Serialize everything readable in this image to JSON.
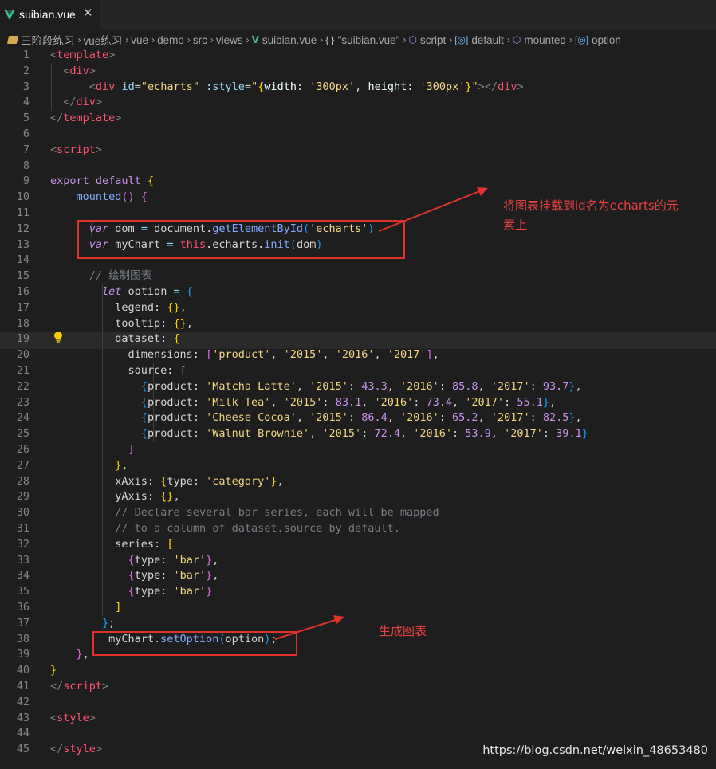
{
  "tab": {
    "title": "suibian.vue",
    "close": "✕"
  },
  "breadcrumb": [
    {
      "icon": "folder-icon",
      "label": "三阶段练习"
    },
    {
      "icon": "",
      "label": "vue练习"
    },
    {
      "icon": "",
      "label": "vue"
    },
    {
      "icon": "",
      "label": "demo"
    },
    {
      "icon": "",
      "label": "src"
    },
    {
      "icon": "",
      "label": "views"
    },
    {
      "icon": "vue-icon",
      "label": "suibian.vue"
    },
    {
      "icon": "braces-icon",
      "label": "\"suibian.vue\""
    },
    {
      "icon": "cube-icon",
      "label": "script"
    },
    {
      "icon": "module-icon",
      "label": "default"
    },
    {
      "icon": "cube-icon",
      "label": "mounted"
    },
    {
      "icon": "module-icon",
      "label": "option"
    }
  ],
  "line_numbers": [
    "1",
    "2",
    "3",
    "4",
    "5",
    "6",
    "7",
    "8",
    "9",
    "10",
    "11",
    "12",
    "13",
    "14",
    "15",
    "16",
    "17",
    "18",
    "19",
    "20",
    "21",
    "22",
    "23",
    "24",
    "25",
    "26",
    "27",
    "28",
    "29",
    "30",
    "31",
    "32",
    "33",
    "34",
    "35",
    "36",
    "37",
    "38",
    "39",
    "40",
    "41",
    "42",
    "43",
    "44",
    "45"
  ],
  "code": [
    [
      [
        "t-br",
        "<"
      ],
      [
        "t-tag",
        "template"
      ],
      [
        "t-br",
        ">"
      ]
    ],
    [
      [
        "t-def",
        "  "
      ],
      [
        "t-br",
        "<"
      ],
      [
        "t-tag",
        "div"
      ],
      [
        "t-br",
        ">"
      ]
    ],
    [
      [
        "t-def",
        "      "
      ],
      [
        "t-br",
        "<"
      ],
      [
        "t-tag",
        "div"
      ],
      [
        "t-def",
        " "
      ],
      [
        "t-attr",
        "id"
      ],
      [
        "t-def",
        "="
      ],
      [
        "t-str",
        "\"echarts\""
      ],
      [
        "t-def",
        " "
      ],
      [
        "t-attr",
        ":style"
      ],
      [
        "t-def",
        "="
      ],
      [
        "t-str",
        "\""
      ],
      [
        "t-br1",
        "{"
      ],
      [
        "t-prop",
        "width"
      ],
      [
        "t-def",
        ": "
      ],
      [
        "t-str",
        "'300px'"
      ],
      [
        "t-def",
        ", "
      ],
      [
        "t-prop",
        "height"
      ],
      [
        "t-def",
        ": "
      ],
      [
        "t-str",
        "'300px'"
      ],
      [
        "t-br1",
        "}"
      ],
      [
        "t-str",
        "\""
      ],
      [
        "t-br",
        ">"
      ],
      [
        "t-br",
        "</"
      ],
      [
        "t-tag",
        "div"
      ],
      [
        "t-br",
        ">"
      ]
    ],
    [
      [
        "t-def",
        "  "
      ],
      [
        "t-br",
        "</"
      ],
      [
        "t-tag",
        "div"
      ],
      [
        "t-br",
        ">"
      ]
    ],
    [
      [
        "t-br",
        "</"
      ],
      [
        "t-tag",
        "template"
      ],
      [
        "t-br",
        ">"
      ]
    ],
    [],
    [
      [
        "t-br",
        "<"
      ],
      [
        "t-tag",
        "script"
      ],
      [
        "t-br",
        ">"
      ]
    ],
    [],
    [
      [
        "t-kw",
        "export"
      ],
      [
        "t-def",
        " "
      ],
      [
        "t-kw",
        "default"
      ],
      [
        "t-def",
        " "
      ],
      [
        "t-br1",
        "{"
      ]
    ],
    [
      [
        "t-def",
        "    "
      ],
      [
        "t-fn",
        "mounted"
      ],
      [
        "t-br2",
        "()"
      ],
      [
        "t-def",
        " "
      ],
      [
        "t-br2",
        "{"
      ]
    ],
    [],
    [
      [
        "t-def",
        "      "
      ],
      [
        "t-kwi",
        "var"
      ],
      [
        "t-def",
        " dom "
      ],
      [
        "t-op",
        "="
      ],
      [
        "t-def",
        " document."
      ],
      [
        "t-fn",
        "getElementById"
      ],
      [
        "t-br3",
        "("
      ],
      [
        "t-str",
        "'echarts'"
      ],
      [
        "t-br3",
        ")"
      ]
    ],
    [
      [
        "t-def",
        "      "
      ],
      [
        "t-kwi",
        "var"
      ],
      [
        "t-def",
        " myChart "
      ],
      [
        "t-op",
        "="
      ],
      [
        "t-def",
        " "
      ],
      [
        "t-this",
        "this"
      ],
      [
        "t-def",
        ".echarts."
      ],
      [
        "t-fn",
        "init"
      ],
      [
        "t-br3",
        "("
      ],
      [
        "t-def",
        "dom"
      ],
      [
        "t-br3",
        ")"
      ]
    ],
    [],
    [
      [
        "t-def",
        "      "
      ],
      [
        "t-com",
        "// 绘制图表"
      ]
    ],
    [
      [
        "t-def",
        "        "
      ],
      [
        "t-kwi",
        "let"
      ],
      [
        "t-def",
        " option "
      ],
      [
        "t-op",
        "="
      ],
      [
        "t-def",
        " "
      ],
      [
        "t-br3",
        "{"
      ]
    ],
    [
      [
        "t-def",
        "          legend: "
      ],
      [
        "t-br1",
        "{}"
      ],
      [
        "t-def",
        ","
      ]
    ],
    [
      [
        "t-def",
        "          tooltip: "
      ],
      [
        "t-br1",
        "{}"
      ],
      [
        "t-def",
        ","
      ]
    ],
    [
      [
        "t-def",
        "          dataset: "
      ],
      [
        "t-br1",
        "{"
      ]
    ],
    [
      [
        "t-def",
        "            dimensions: "
      ],
      [
        "t-br2",
        "["
      ],
      [
        "t-str",
        "'product'"
      ],
      [
        "t-def",
        ", "
      ],
      [
        "t-str",
        "'2015'"
      ],
      [
        "t-def",
        ", "
      ],
      [
        "t-str",
        "'2016'"
      ],
      [
        "t-def",
        ", "
      ],
      [
        "t-str",
        "'2017'"
      ],
      [
        "t-br2",
        "]"
      ],
      [
        "t-def",
        ","
      ]
    ],
    [
      [
        "t-def",
        "            source: "
      ],
      [
        "t-br2",
        "["
      ]
    ],
    [
      [
        "t-def",
        "              "
      ],
      [
        "t-br3",
        "{"
      ],
      [
        "t-def",
        "product: "
      ],
      [
        "t-str",
        "'Matcha Latte'"
      ],
      [
        "t-def",
        ", "
      ],
      [
        "t-str",
        "'2015'"
      ],
      [
        "t-def",
        ": "
      ],
      [
        "t-num",
        "43.3"
      ],
      [
        "t-def",
        ", "
      ],
      [
        "t-str",
        "'2016'"
      ],
      [
        "t-def",
        ": "
      ],
      [
        "t-num",
        "85.8"
      ],
      [
        "t-def",
        ", "
      ],
      [
        "t-str",
        "'2017'"
      ],
      [
        "t-def",
        ": "
      ],
      [
        "t-num",
        "93.7"
      ],
      [
        "t-br3",
        "}"
      ],
      [
        "t-def",
        ","
      ]
    ],
    [
      [
        "t-def",
        "              "
      ],
      [
        "t-br3",
        "{"
      ],
      [
        "t-def",
        "product: "
      ],
      [
        "t-str",
        "'Milk Tea'"
      ],
      [
        "t-def",
        ", "
      ],
      [
        "t-str",
        "'2015'"
      ],
      [
        "t-def",
        ": "
      ],
      [
        "t-num",
        "83.1"
      ],
      [
        "t-def",
        ", "
      ],
      [
        "t-str",
        "'2016'"
      ],
      [
        "t-def",
        ": "
      ],
      [
        "t-num",
        "73.4"
      ],
      [
        "t-def",
        ", "
      ],
      [
        "t-str",
        "'2017'"
      ],
      [
        "t-def",
        ": "
      ],
      [
        "t-num",
        "55.1"
      ],
      [
        "t-br3",
        "}"
      ],
      [
        "t-def",
        ","
      ]
    ],
    [
      [
        "t-def",
        "              "
      ],
      [
        "t-br3",
        "{"
      ],
      [
        "t-def",
        "product: "
      ],
      [
        "t-str",
        "'Cheese Cocoa'"
      ],
      [
        "t-def",
        ", "
      ],
      [
        "t-str",
        "'2015'"
      ],
      [
        "t-def",
        ": "
      ],
      [
        "t-num",
        "86.4"
      ],
      [
        "t-def",
        ", "
      ],
      [
        "t-str",
        "'2016'"
      ],
      [
        "t-def",
        ": "
      ],
      [
        "t-num",
        "65.2"
      ],
      [
        "t-def",
        ", "
      ],
      [
        "t-str",
        "'2017'"
      ],
      [
        "t-def",
        ": "
      ],
      [
        "t-num",
        "82.5"
      ],
      [
        "t-br3",
        "}"
      ],
      [
        "t-def",
        ","
      ]
    ],
    [
      [
        "t-def",
        "              "
      ],
      [
        "t-br3",
        "{"
      ],
      [
        "t-def",
        "product: "
      ],
      [
        "t-str",
        "'Walnut Brownie'"
      ],
      [
        "t-def",
        ", "
      ],
      [
        "t-str",
        "'2015'"
      ],
      [
        "t-def",
        ": "
      ],
      [
        "t-num",
        "72.4"
      ],
      [
        "t-def",
        ", "
      ],
      [
        "t-str",
        "'2016'"
      ],
      [
        "t-def",
        ": "
      ],
      [
        "t-num",
        "53.9"
      ],
      [
        "t-def",
        ", "
      ],
      [
        "t-str",
        "'2017'"
      ],
      [
        "t-def",
        ": "
      ],
      [
        "t-num",
        "39.1"
      ],
      [
        "t-br3",
        "}"
      ]
    ],
    [
      [
        "t-def",
        "            "
      ],
      [
        "t-br2",
        "]"
      ]
    ],
    [
      [
        "t-def",
        "          "
      ],
      [
        "t-br1",
        "}"
      ],
      [
        "t-def",
        ","
      ]
    ],
    [
      [
        "t-def",
        "          xAxis: "
      ],
      [
        "t-br1",
        "{"
      ],
      [
        "t-def",
        "type: "
      ],
      [
        "t-str",
        "'category'"
      ],
      [
        "t-br1",
        "}"
      ],
      [
        "t-def",
        ","
      ]
    ],
    [
      [
        "t-def",
        "          yAxis: "
      ],
      [
        "t-br1",
        "{}"
      ],
      [
        "t-def",
        ","
      ]
    ],
    [
      [
        "t-def",
        "          "
      ],
      [
        "t-com",
        "// Declare several bar series, each will be mapped"
      ]
    ],
    [
      [
        "t-def",
        "          "
      ],
      [
        "t-com",
        "// to a column of dataset.source by default."
      ]
    ],
    [
      [
        "t-def",
        "          series: "
      ],
      [
        "t-br1",
        "["
      ]
    ],
    [
      [
        "t-def",
        "            "
      ],
      [
        "t-br2",
        "{"
      ],
      [
        "t-def",
        "type: "
      ],
      [
        "t-str",
        "'bar'"
      ],
      [
        "t-br2",
        "}"
      ],
      [
        "t-def",
        ","
      ]
    ],
    [
      [
        "t-def",
        "            "
      ],
      [
        "t-br2",
        "{"
      ],
      [
        "t-def",
        "type: "
      ],
      [
        "t-str",
        "'bar'"
      ],
      [
        "t-br2",
        "}"
      ],
      [
        "t-def",
        ","
      ]
    ],
    [
      [
        "t-def",
        "            "
      ],
      [
        "t-br2",
        "{"
      ],
      [
        "t-def",
        "type: "
      ],
      [
        "t-str",
        "'bar'"
      ],
      [
        "t-br2",
        "}"
      ]
    ],
    [
      [
        "t-def",
        "          "
      ],
      [
        "t-br1",
        "]"
      ]
    ],
    [
      [
        "t-def",
        "        "
      ],
      [
        "t-br3",
        "}"
      ],
      [
        "t-def",
        ";"
      ]
    ],
    [
      [
        "t-def",
        "         myChart."
      ],
      [
        "t-fn",
        "setOption"
      ],
      [
        "t-br3",
        "("
      ],
      [
        "t-def",
        "option"
      ],
      [
        "t-br3",
        ")"
      ],
      [
        "t-def",
        ";"
      ]
    ],
    [
      [
        "t-def",
        "    "
      ],
      [
        "t-br2",
        "}"
      ],
      [
        "t-def",
        ","
      ]
    ],
    [
      [
        "t-br1",
        "}"
      ]
    ],
    [
      [
        "t-br",
        "</"
      ],
      [
        "t-tag",
        "script"
      ],
      [
        "t-br",
        ">"
      ]
    ],
    [],
    [
      [
        "t-br",
        "<"
      ],
      [
        "t-tag",
        "style"
      ],
      [
        "t-br",
        ">"
      ]
    ],
    [],
    [
      [
        "t-br",
        "</"
      ],
      [
        "t-tag",
        "style"
      ],
      [
        "t-br",
        ">"
      ]
    ]
  ],
  "annotations": {
    "mount": "将图表挂载到id名为echarts的元素上",
    "mount_line1": "将图表挂载到id名为echarts的元",
    "mount_line2": "素上",
    "generate": "生成图表"
  },
  "watermark": "https://blog.csdn.net/weixin_48653480",
  "colors": {
    "annotation_red": "#e0332b",
    "editor_bg": "#1e1e1e",
    "vue_green": "#41b883"
  }
}
